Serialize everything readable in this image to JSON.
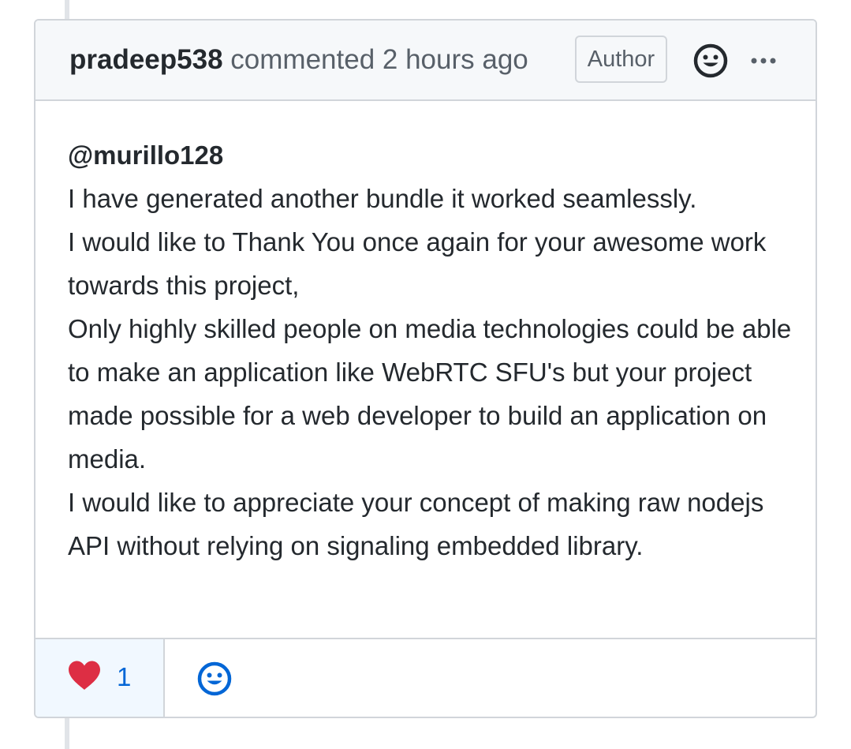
{
  "comment": {
    "author": "pradeep538",
    "action": "commented",
    "time": "2 hours ago",
    "badge": "Author",
    "header_icons": [
      "smiley-icon",
      "kebab-horizontal-icon"
    ],
    "mention": "@murillo128",
    "body_lines": [
      "I have generated another bundle it worked seamlessly.",
      "I would like to Thank You once again for your awesome work towards this project,",
      "Only highly skilled people on media technologies could be able to make an application like WebRTC SFU's but your project made possible for a web developer to build an application on media.",
      "I would like to appreciate your concept of making raw nodejs API without relying on signaling embedded library."
    ]
  },
  "reactions": {
    "items": [
      {
        "icon": "heart-icon",
        "count": "1"
      }
    ],
    "add_icon": "smiley-icon"
  },
  "colors": {
    "border": "#d1d5da",
    "header_bg": "#f6f8fa",
    "text": "#24292e",
    "muted": "#586069",
    "link_blue": "#0366d6",
    "reaction_bg": "#f1f8ff",
    "heart_red": "#dd2e44"
  }
}
